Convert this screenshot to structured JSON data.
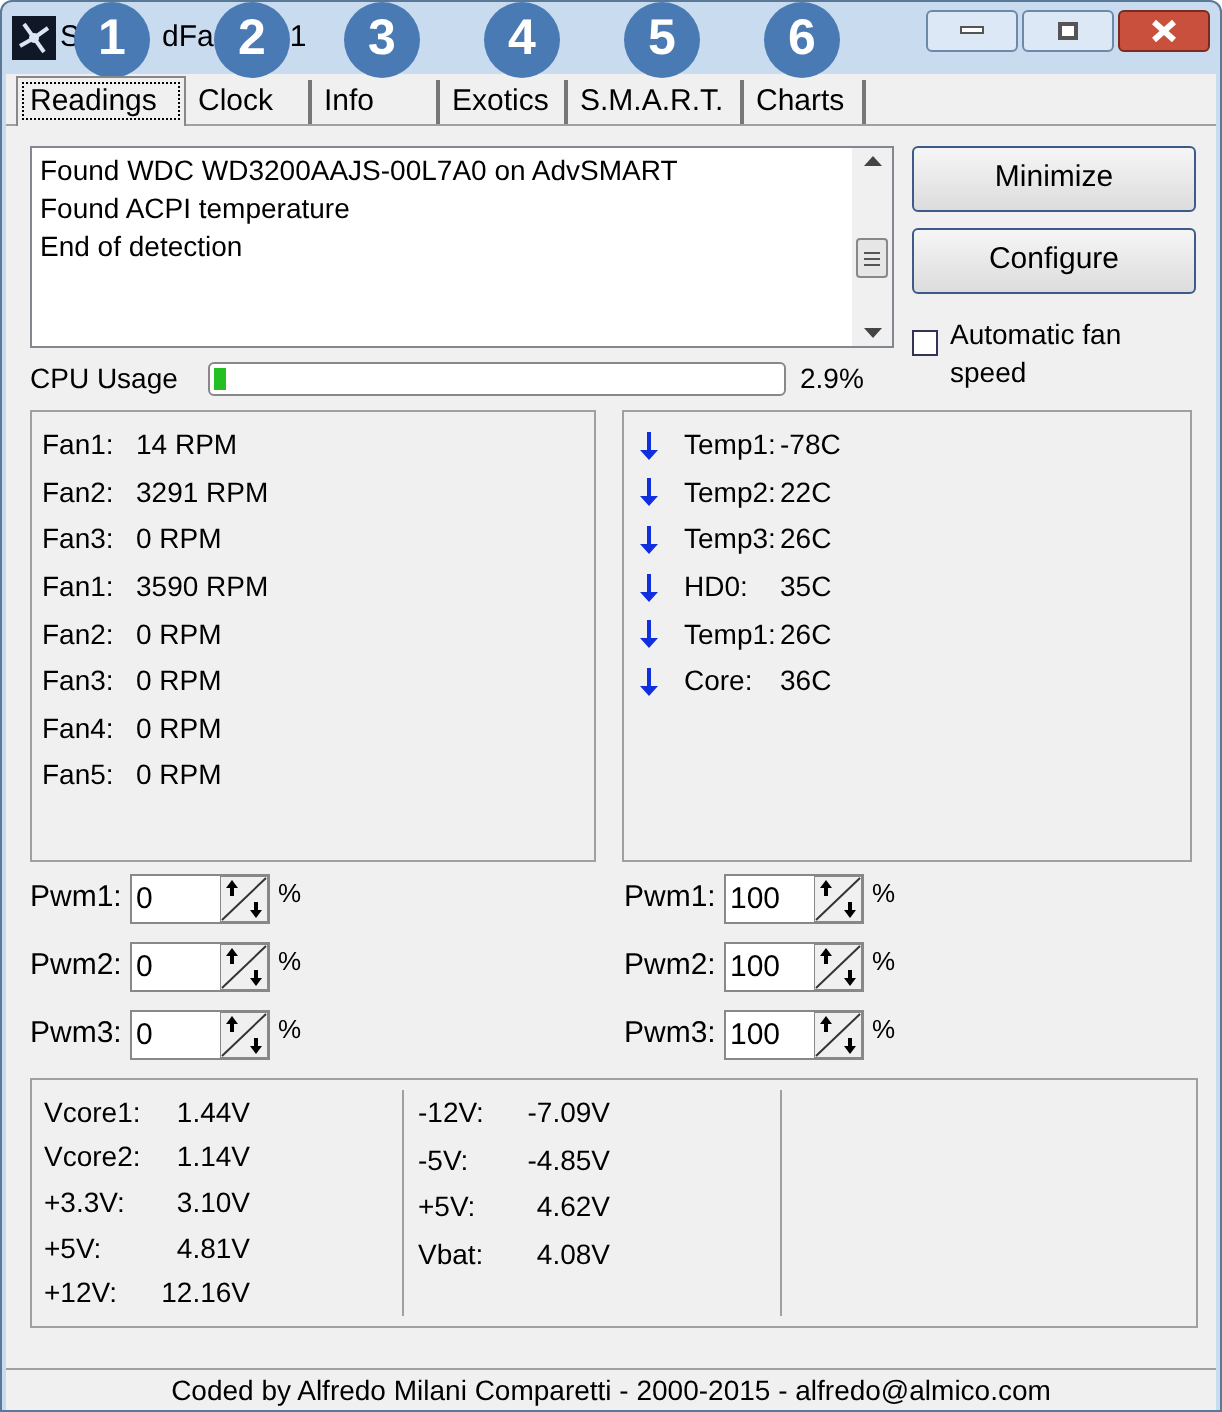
{
  "window": {
    "title_fragments": [
      "S",
      "dFa",
      "1"
    ]
  },
  "callouts": [
    "1",
    "2",
    "3",
    "4",
    "5",
    "6"
  ],
  "tabs": [
    {
      "label": "Readings",
      "selected": true
    },
    {
      "label": "Clock",
      "selected": false
    },
    {
      "label": "Info",
      "selected": false
    },
    {
      "label": "Exotics",
      "selected": false
    },
    {
      "label": "S.M.A.R.T.",
      "selected": false
    },
    {
      "label": "Charts",
      "selected": false
    }
  ],
  "log": [
    "Found WDC WD3200AAJS-00L7A0 on AdvSMART",
    "Found ACPI temperature",
    "End of detection"
  ],
  "buttons": [
    "Minimize",
    "Configure"
  ],
  "auto_fan_speed": {
    "label": "Automatic fan speed",
    "checked": false
  },
  "cpu_usage": {
    "label": "CPU Usage",
    "level": 0.02,
    "reading": "2.9%"
  },
  "fans": [
    {
      "label": "Fan1:",
      "value": "14 RPM"
    },
    {
      "label": "Fan2:",
      "value": "3291 RPM"
    },
    {
      "label": "Fan3:",
      "value": "0 RPM"
    },
    {
      "label": "Fan1:",
      "value": "3590 RPM"
    },
    {
      "label": "Fan2:",
      "value": "0 RPM"
    },
    {
      "label": "Fan3:",
      "value": "0 RPM"
    },
    {
      "label": "Fan4:",
      "value": "0 RPM"
    },
    {
      "label": "Fan5:",
      "value": "0 RPM"
    }
  ],
  "temps": [
    {
      "label": "Temp1:",
      "value": "-78C",
      "falling": true
    },
    {
      "label": "Temp2:",
      "value": "22C",
      "falling": true
    },
    {
      "label": "Temp3:",
      "value": "26C",
      "falling": true
    },
    {
      "label": "HD0:",
      "value": "35C",
      "falling": true
    },
    {
      "label": "Temp1:",
      "value": "26C",
      "falling": true
    },
    {
      "label": "Core:",
      "value": "36C",
      "falling": true
    }
  ],
  "pwm_left": [
    {
      "label": "Pwm1:",
      "value": "0",
      "unit": "%"
    },
    {
      "label": "Pwm2:",
      "value": "0",
      "unit": "%"
    },
    {
      "label": "Pwm3:",
      "value": "0",
      "unit": "%"
    }
  ],
  "pwm_right": [
    {
      "label": "Pwm1:",
      "value": "100",
      "unit": "%"
    },
    {
      "label": "Pwm2:",
      "value": "100",
      "unit": "%"
    },
    {
      "label": "Pwm3:",
      "value": "100",
      "unit": "%"
    }
  ],
  "voltages": [
    [
      {
        "label": "Vcore1:",
        "value": "1.44V"
      },
      {
        "label": "Vcore2:",
        "value": "1.14V"
      },
      {
        "label": "+3.3V:",
        "value": "3.10V"
      },
      {
        "label": "+5V:",
        "value": "4.81V"
      },
      {
        "label": "+12V:",
        "value": "12.16V"
      }
    ],
    [
      {
        "label": "-12V:",
        "value": "-7.09V"
      },
      {
        "label": "-5V:",
        "value": "-4.85V"
      },
      {
        "label": "+5V:",
        "value": "4.62V"
      },
      {
        "label": "Vbat:",
        "value": "4.08V"
      }
    ]
  ],
  "status_bar": "Coded by Alfredo Milani Comparetti - 2000-2015 - alfredo@almico.com"
}
